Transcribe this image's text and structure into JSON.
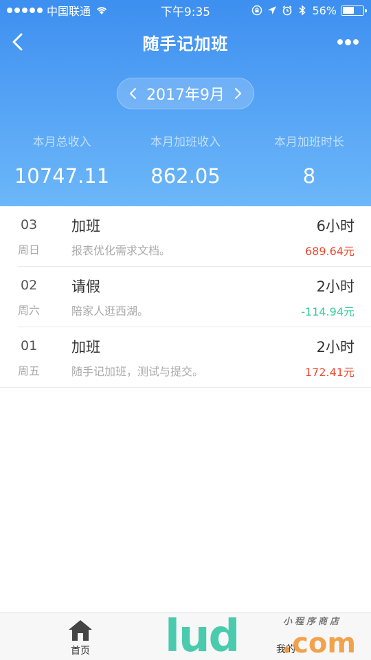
{
  "status_bar": {
    "carrier": "中国联通",
    "time": "下午9:35",
    "battery_percent": "56%",
    "battery_level": 0.56,
    "icons": [
      "signal-dots-icon",
      "wifi-icon",
      "rotation-lock-icon",
      "location-arrow-icon",
      "alarm-icon",
      "bluetooth-icon",
      "battery-icon"
    ]
  },
  "navbar": {
    "title": "随手记加班",
    "back_icon": "chevron-left-icon",
    "more_icon": "more-dots-icon"
  },
  "month_selector": {
    "label": "2017年9月",
    "prev_icon": "chevron-left-icon",
    "next_icon": "chevron-right-icon"
  },
  "stats": [
    {
      "label": "本月总收入",
      "value": "10747.11"
    },
    {
      "label": "本月加班收入",
      "value": "862.05"
    },
    {
      "label": "本月加班时长",
      "value": "8"
    }
  ],
  "records": [
    {
      "day": "03",
      "weekday": "周日",
      "type": "加班",
      "desc": "报表优化需求文档。",
      "hours": "6小时",
      "amount": "689.64元",
      "amount_color": "#f0482f"
    },
    {
      "day": "02",
      "weekday": "周六",
      "type": "请假",
      "desc": "陪家人逛西湖。",
      "hours": "2小时",
      "amount": "-114.94元",
      "amount_color": "#2ecf9a"
    },
    {
      "day": "01",
      "weekday": "周五",
      "type": "加班",
      "desc": "随手记加班，测试与提交。",
      "hours": "2小时",
      "amount": "172.41元",
      "amount_color": "#f0482f"
    }
  ],
  "tabbar": {
    "home_label": "首页",
    "home_icon": "home-icon",
    "mine_label": "我的"
  },
  "watermark": {
    "main": "lud",
    "suffix": ".com",
    "sub": "小程序商店"
  },
  "colors": {
    "header_top": "#3d8ff0",
    "header_bottom": "#6cb7f8",
    "income": "#f0482f",
    "deduction": "#2ecf9a"
  }
}
